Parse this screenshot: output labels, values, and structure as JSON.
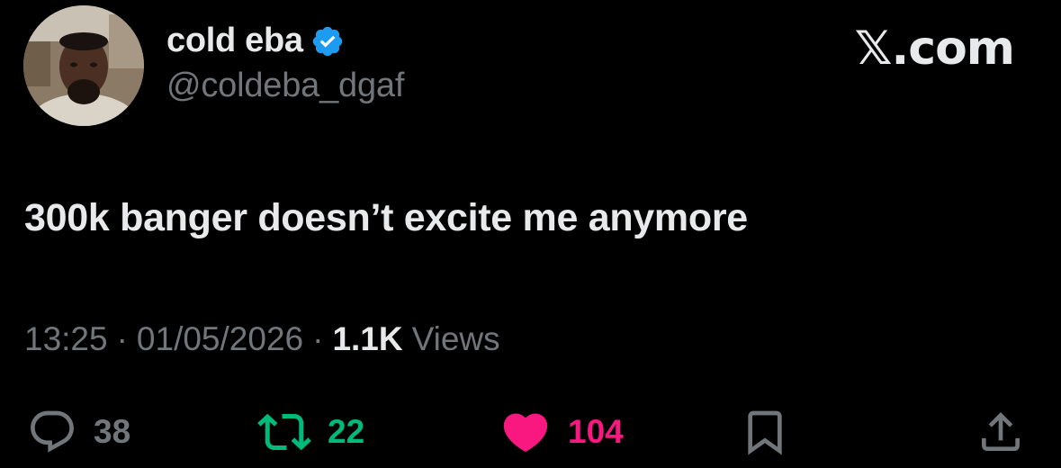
{
  "author": {
    "display_name": "cold eba",
    "handle": "@coldeba_dgaf",
    "verified": true
  },
  "brand": "𝕏.com",
  "tweet": {
    "text": "300k banger doesn’t excite me anymore",
    "time": "13:25",
    "date": "01/05/2026",
    "views_count": "1.1K",
    "views_label": "Views",
    "separator": "·"
  },
  "actions": {
    "replies": "38",
    "retweets": "22",
    "likes": "104"
  },
  "colors": {
    "background": "#000000",
    "text": "#e7e9ea",
    "muted": "#71767b",
    "verified": "#1d9bf0",
    "retweet": "#00ba7c",
    "like": "#f91880"
  },
  "icons": {
    "verified": "verified-badge-icon",
    "reply": "reply-bubble-icon",
    "retweet": "retweet-arrows-icon",
    "like": "heart-icon",
    "bookmark": "bookmark-icon",
    "share": "share-icon"
  }
}
